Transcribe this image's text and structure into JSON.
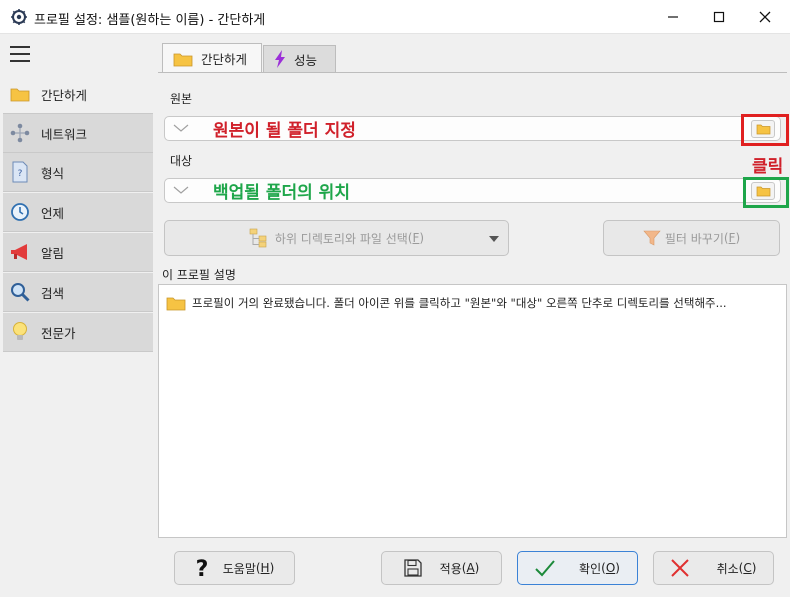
{
  "window": {
    "title": "프로필 설정: 샘플(원하는 이름) - 간단하게",
    "icon": "gear-icon"
  },
  "sidebar": {
    "items": [
      {
        "label": "간단하게",
        "icon": "folder-icon",
        "active": true
      },
      {
        "label": "네트워크",
        "icon": "network-icon",
        "active": false
      },
      {
        "label": "형식",
        "icon": "question-file-icon",
        "active": false
      },
      {
        "label": "언제",
        "icon": "clock-icon",
        "active": false
      },
      {
        "label": "알림",
        "icon": "megaphone-icon",
        "active": false
      },
      {
        "label": "검색",
        "icon": "magnifier-icon",
        "active": false
      },
      {
        "label": "전문가",
        "icon": "lightbulb-icon",
        "active": false
      }
    ]
  },
  "tabs": [
    {
      "label": "간단하게",
      "icon": "folder-icon",
      "active": true
    },
    {
      "label": "성능",
      "icon": "lightning-icon",
      "active": false
    }
  ],
  "source": {
    "label": "원본",
    "value": "",
    "annotation": "원본이 될 폴더 지정",
    "annotation_color": "#d0202a"
  },
  "target": {
    "label": "대상",
    "value": "",
    "annotation": "백업될 폴더의 위치",
    "annotation_color": "#1ea64a"
  },
  "click_annotation": "클릭",
  "buttons": {
    "subdir": {
      "label": "하위 디렉토리와 파일 선택",
      "mnemonic": "F"
    },
    "filter": {
      "label": "필터 바꾸기",
      "mnemonic": "F"
    },
    "help": {
      "label": "도움말",
      "mnemonic": "H"
    },
    "apply": {
      "label": "적용",
      "mnemonic": "A"
    },
    "ok": {
      "label": "확인",
      "mnemonic": "O"
    },
    "cancel": {
      "label": "취소",
      "mnemonic": "C"
    }
  },
  "description": {
    "label": "이 프로필 설명",
    "text": "프로필이 거의 완료됐습니다. 폴더 아이콘 위를 클릭하고 \"원본\"와 \"대상\" 오른쪽 단추로 디렉토리를 선택해주..."
  },
  "colors": {
    "highlight_red": "#e02020",
    "highlight_green": "#1ea64a",
    "folder_yellow": "#f6c343"
  }
}
